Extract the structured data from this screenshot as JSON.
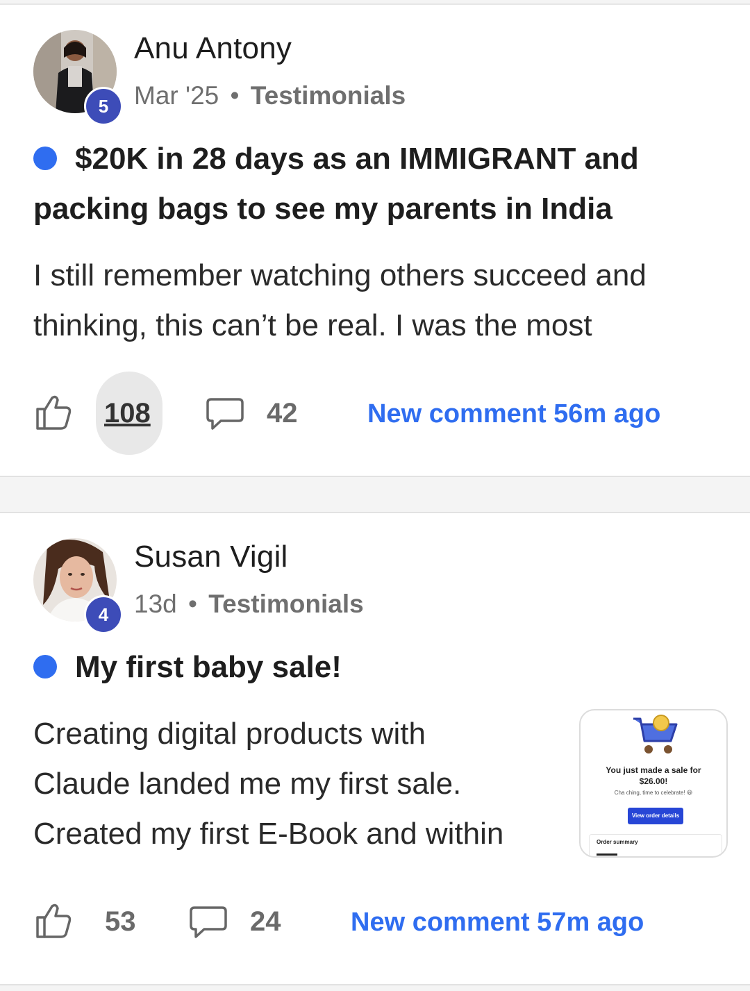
{
  "colors": {
    "accent": "#2f6df0",
    "badge": "#3d4cb8",
    "muted": "#6f6f6f"
  },
  "posts": [
    {
      "author": "Anu Antony",
      "level": "5",
      "date": "Mar '25",
      "separator": "•",
      "category": "Testimonials",
      "title": "$20K in 28 days as an IMMIGRANT and packing bags to see my parents in India",
      "body_line1": "I still remember watching others succeed and",
      "body_line2": "thinking, this can’t be real. I was the most",
      "likes": "108",
      "comments": "42",
      "new_comment": "New comment 56m ago",
      "icons": {
        "like": "thumbs-up-icon",
        "comment": "comment-bubble-icon"
      }
    },
    {
      "author": "Susan Vigil",
      "level": "4",
      "date": "13d",
      "separator": "•",
      "category": "Testimonials",
      "title": "My first baby sale!",
      "body_line1": "Creating digital products with",
      "body_line2": "Claude landed me my first sale.",
      "body_line3": "Created my first E-Book and within",
      "likes": "53",
      "comments": "24",
      "new_comment": "New comment 57m ago",
      "attachment": {
        "line1": "You just made a sale for",
        "line2": "$26.00!",
        "sub": "Cha ching, time to celebrate! 😃",
        "button": "View order details",
        "summary": "Order summary"
      },
      "icons": {
        "like": "thumbs-up-icon",
        "comment": "comment-bubble-icon"
      }
    }
  ]
}
